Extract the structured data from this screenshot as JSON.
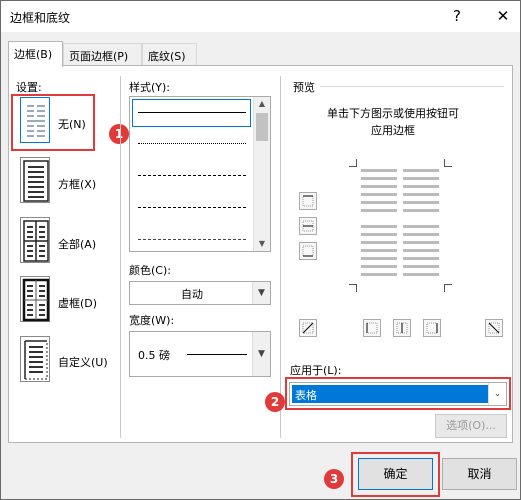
{
  "window": {
    "title": "边框和底纹",
    "help_icon": "?",
    "close_icon": "✕"
  },
  "tabs": [
    {
      "label": "边框(B)"
    },
    {
      "label": "页面边框(P)"
    },
    {
      "label": "底纹(S)"
    }
  ],
  "settings": {
    "label": "设置:",
    "items": [
      {
        "label": "无(N)"
      },
      {
        "label": "方框(X)"
      },
      {
        "label": "全部(A)"
      },
      {
        "label": "虚框(D)"
      },
      {
        "label": "自定义(U)"
      }
    ]
  },
  "style": {
    "label": "样式(Y):"
  },
  "color": {
    "label": "颜色(C):",
    "value": "自动"
  },
  "width": {
    "label": "宽度(W):",
    "value": "0.5 磅"
  },
  "preview": {
    "label": "预览",
    "hint_line1": "单击下方图示或使用按钮可",
    "hint_line2": "应用边框"
  },
  "apply_to": {
    "label": "应用于(L):",
    "value": "表格"
  },
  "buttons": {
    "options": "选项(O)...",
    "ok": "确定",
    "cancel": "取消"
  },
  "annotations": [
    "1",
    "2",
    "3"
  ],
  "colors": {
    "highlight": "#e03a3a",
    "selection": "#0078d7"
  }
}
